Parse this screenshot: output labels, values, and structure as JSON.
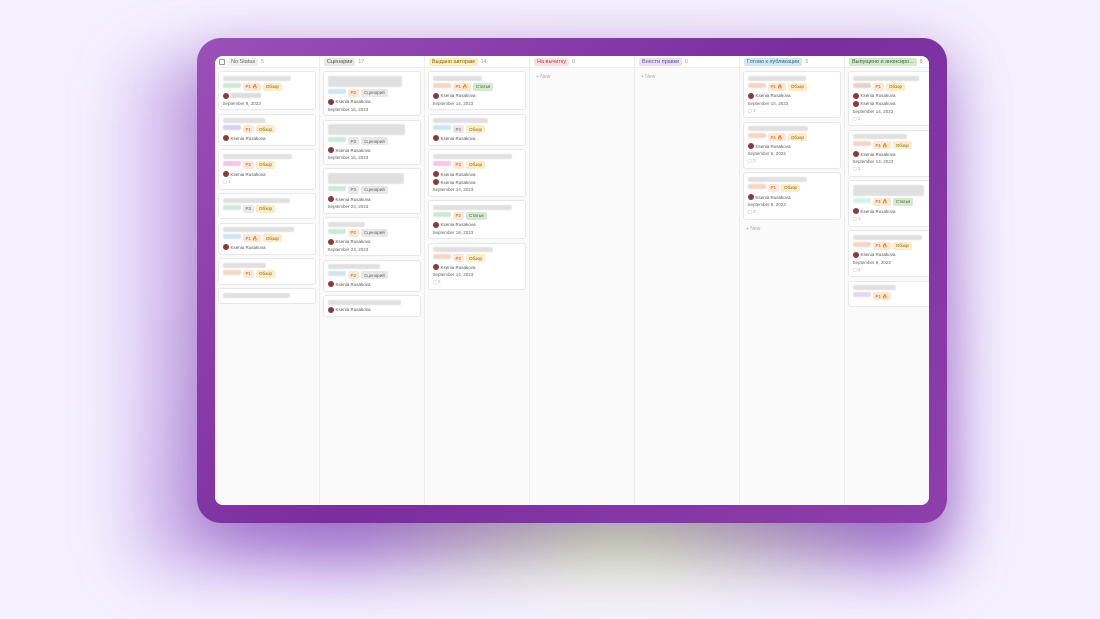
{
  "assignee_name": "Ksenia Rusakova",
  "new_label": "+ New",
  "comment_icon": "▢",
  "columns": [
    {
      "title": "No Status",
      "count": "5",
      "color": "#f0f0f0",
      "textcolor": "#666",
      "has_icon": true,
      "cards": [
        {
          "tags": [
            {
              "t": "blur",
              "c": "#cde9d5"
            },
            {
              "t": "P1 🔥",
              "c": "#fde8d8",
              "tc": "#b85c00"
            },
            {
              "t": "Обзор",
              "c": "#fdecc8",
              "tc": "#8a6500"
            }
          ],
          "assignee": "blur",
          "date": "September 9, 2023"
        },
        {
          "tags": [
            {
              "t": "blur",
              "c": "#d6d0f0"
            },
            {
              "t": "P1",
              "c": "#fde8d8",
              "tc": "#b85c00"
            },
            {
              "t": "Обзор",
              "c": "#fdecc8",
              "tc": "#8a6500"
            }
          ],
          "assignee": true,
          "date": ""
        },
        {
          "tags": [
            {
              "t": "blur",
              "c": "#f5c6e0"
            },
            {
              "t": "P2",
              "c": "#fde8d8",
              "tc": "#b85c00"
            },
            {
              "t": "Обзор",
              "c": "#fdecc8",
              "tc": "#8a6500"
            }
          ],
          "assignee": true,
          "date": "",
          "comments": "1"
        },
        {
          "tags": [
            {
              "t": "blur",
              "c": "#cde9d5"
            },
            {
              "t": "P3",
              "c": "#e8e8e8",
              "tc": "#666"
            },
            {
              "t": "Обзор",
              "c": "#fdecc8",
              "tc": "#8a6500"
            }
          ],
          "date": ""
        },
        {
          "tags": [
            {
              "t": "blur",
              "c": "#d0e4f5"
            },
            {
              "t": "P1 🔥",
              "c": "#fde8d8",
              "tc": "#b85c00"
            },
            {
              "t": "Обзор",
              "c": "#fdecc8",
              "tc": "#8a6500"
            }
          ],
          "assignee": true,
          "date": ""
        },
        {
          "tags": [
            {
              "t": "blur",
              "c": "#f5d6c6"
            },
            {
              "t": "P1",
              "c": "#fde8d8",
              "tc": "#b85c00"
            },
            {
              "t": "Обзор",
              "c": "#fdecc8",
              "tc": "#8a6500"
            }
          ],
          "date": ""
        },
        {
          "tags": [],
          "date": ""
        }
      ]
    },
    {
      "title": "Сценарии",
      "count": "17",
      "color": "#e8e8e8",
      "textcolor": "#555",
      "cards": [
        {
          "tall": true,
          "tags": [
            {
              "t": "blur",
              "c": "#d0e4f5"
            },
            {
              "t": "P2",
              "c": "#fde8d8",
              "tc": "#b85c00"
            },
            {
              "t": "Сценарий",
              "c": "#e8e8e8",
              "tc": "#666"
            }
          ],
          "assignee": true,
          "date": "September 16, 2023"
        },
        {
          "tall": true,
          "tags": [
            {
              "t": "blur",
              "c": "#cde9d5"
            },
            {
              "t": "P3",
              "c": "#e8e8e8",
              "tc": "#666"
            },
            {
              "t": "Сценарий",
              "c": "#e8e8e8",
              "tc": "#666"
            }
          ],
          "assignee": true,
          "date": "September 16, 2023"
        },
        {
          "tall": true,
          "tags": [
            {
              "t": "blur",
              "c": "#cde9d5"
            },
            {
              "t": "P3",
              "c": "#e8e8e8",
              "tc": "#666"
            },
            {
              "t": "Сценарий",
              "c": "#e8e8e8",
              "tc": "#666"
            }
          ],
          "assignee": true,
          "date": "September 23, 2023"
        },
        {
          "tags": [
            {
              "t": "blur",
              "c": "#cde9d5"
            },
            {
              "t": "P2",
              "c": "#fde8d8",
              "tc": "#b85c00"
            },
            {
              "t": "Сценарий",
              "c": "#e8e8e8",
              "tc": "#666"
            }
          ],
          "assignee": true,
          "date": "September 23, 2023"
        },
        {
          "tags": [
            {
              "t": "blur",
              "c": "#d0e4f5"
            },
            {
              "t": "P2",
              "c": "#fde8d8",
              "tc": "#b85c00"
            },
            {
              "t": "Сценарий",
              "c": "#e8e8e8",
              "tc": "#666"
            }
          ],
          "assignee": true,
          "date": ""
        },
        {
          "tags": [],
          "assignee": true
        }
      ]
    },
    {
      "title": "Выдано авторам",
      "count": "14",
      "color": "#fdecc8",
      "textcolor": "#8a6500",
      "cards": [
        {
          "tags": [
            {
              "t": "blur",
              "c": "#f5d6c6"
            },
            {
              "t": "P1 🔥",
              "c": "#fde8d8",
              "tc": "#b85c00"
            },
            {
              "t": "Статья",
              "c": "#d6e8d0",
              "tc": "#3a6b2e"
            }
          ],
          "assignee": true,
          "date": "September 14, 2023"
        },
        {
          "tags": [
            {
              "t": "blur",
              "c": "#d0e4f5"
            },
            {
              "t": "P3",
              "c": "#e8e8e8",
              "tc": "#666"
            },
            {
              "t": "Обзор",
              "c": "#fdecc8",
              "tc": "#8a6500"
            }
          ],
          "assignee": true,
          "date": ""
        },
        {
          "tags": [
            {
              "t": "blur",
              "c": "#f5c6e0"
            },
            {
              "t": "P2",
              "c": "#fde8d8",
              "tc": "#b85c00"
            },
            {
              "t": "Обзор",
              "c": "#fdecc8",
              "tc": "#8a6500"
            }
          ],
          "assignee": true,
          "assignee2": true,
          "date": "September 14, 2023"
        },
        {
          "tags": [
            {
              "t": "blur",
              "c": "#cde9d5"
            },
            {
              "t": "P2",
              "c": "#fde8d8",
              "tc": "#b85c00"
            },
            {
              "t": "Статья",
              "c": "#d6e8d0",
              "tc": "#3a6b2e"
            }
          ],
          "assignee": true,
          "date": "September 18, 2023"
        },
        {
          "tags": [
            {
              "t": "blur",
              "c": "#f5d6c6"
            },
            {
              "t": "P2",
              "c": "#fde8d8",
              "tc": "#b85c00"
            },
            {
              "t": "Обзор",
              "c": "#fdecc8",
              "tc": "#8a6500"
            }
          ],
          "assignee": true,
          "date": "September 14, 2023",
          "comments": "2"
        }
      ]
    },
    {
      "title": "На вычитку",
      "count": "0",
      "color": "#fce0e0",
      "textcolor": "#b84040",
      "empty": true
    },
    {
      "title": "Внести правки",
      "count": "0",
      "color": "#e8dff5",
      "textcolor": "#6b4a9e",
      "empty": true
    },
    {
      "title": "Готово к публикации",
      "count": "5",
      "color": "#d0e8f5",
      "textcolor": "#2e6b8a",
      "cards": [
        {
          "tags": [
            {
              "t": "blur",
              "c": "#f5d6c6"
            },
            {
              "t": "P1 🔥",
              "c": "#fde8d8",
              "tc": "#b85c00"
            },
            {
              "t": "Обзор",
              "c": "#fdecc8",
              "tc": "#8a6500"
            }
          ],
          "assignee": true,
          "date": "September 14, 2023",
          "comments": "3"
        },
        {
          "tags": [
            {
              "t": "blur",
              "c": "#f5d6c6"
            },
            {
              "t": "P1 🔥",
              "c": "#fde8d8",
              "tc": "#b85c00"
            },
            {
              "t": "Обзор",
              "c": "#fdecc8",
              "tc": "#8a6500"
            }
          ],
          "assignee": true,
          "date": "September 5, 2023",
          "comments": "3"
        },
        {
          "tags": [
            {
              "t": "blur",
              "c": "#f5d6c6"
            },
            {
              "t": "P1",
              "c": "#fde8d8",
              "tc": "#b85c00"
            },
            {
              "t": "Обзор",
              "c": "#fdecc8",
              "tc": "#8a6500"
            }
          ],
          "assignee": true,
          "date": "September 8, 2023",
          "comments": "3"
        }
      ],
      "footer_new": true
    },
    {
      "title": "Выпущено и анонсиро...",
      "count": "8",
      "color": "#d6e8d0",
      "textcolor": "#3a6b2e",
      "cards": [
        {
          "tags": [
            {
              "t": "blur",
              "c": "#e8d0d0"
            },
            {
              "t": "P1",
              "c": "#fde8d8",
              "tc": "#b85c00"
            },
            {
              "t": "Обзор",
              "c": "#fdecc8",
              "tc": "#8a6500"
            }
          ],
          "assignee": true,
          "assignee2": true,
          "date": "September 14, 2023",
          "comments": "2"
        },
        {
          "tags": [
            {
              "t": "blur",
              "c": "#f5d6c6"
            },
            {
              "t": "P1 🔥",
              "c": "#fde8d8",
              "tc": "#b85c00"
            },
            {
              "t": "Обзор",
              "c": "#fdecc8",
              "tc": "#8a6500"
            }
          ],
          "assignee": true,
          "date": "September 14, 2023",
          "comments": "3"
        },
        {
          "tall": true,
          "tags": [
            {
              "t": "blur",
              "c": "#d0f5e8"
            },
            {
              "t": "P1 🔥",
              "c": "#fde8d8",
              "tc": "#b85c00"
            },
            {
              "t": "Статья",
              "c": "#d6e8d0",
              "tc": "#3a6b2e"
            }
          ],
          "assignee": true,
          "date": "",
          "comments": "1"
        },
        {
          "tags": [
            {
              "t": "blur",
              "c": "#f5d6c6"
            },
            {
              "t": "P1 🔥",
              "c": "#fde8d8",
              "tc": "#b85c00"
            },
            {
              "t": "Обзор",
              "c": "#fdecc8",
              "tc": "#8a6500"
            }
          ],
          "assignee": true,
          "date": "September 9, 2023",
          "comments": "3"
        },
        {
          "tags": [
            {
              "t": "blur",
              "c": "#e8d6f5"
            },
            {
              "t": "P1 🔥",
              "c": "#fde8d8",
              "tc": "#b85c00"
            }
          ]
        }
      ]
    }
  ]
}
